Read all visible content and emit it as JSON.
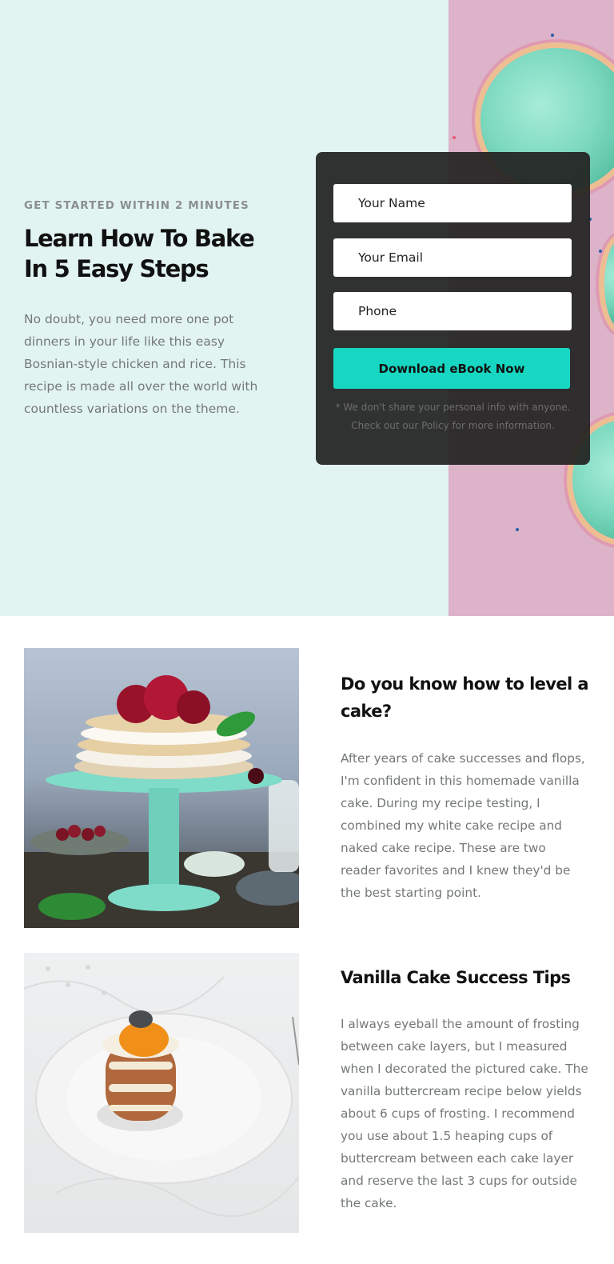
{
  "hero": {
    "eyebrow": "GET STARTED WITHIN 2 MINUTES",
    "headline": "Learn How To Bake In 5 Easy Steps",
    "body": "No doubt, you need more one pot dinners in your life like this easy Bosnian-style chicken and rice. This recipe is made all over the world with countless variations on the theme.",
    "photo_icon": "cupcakes-photo"
  },
  "form": {
    "name_placeholder": "Your Name",
    "email_placeholder": "Your Email",
    "phone_placeholder": "Phone",
    "button_label": "Download eBook Now",
    "disclaimer": "* We don't share your personal info with anyone. Check out our Policy for more information.",
    "button_color": "#17d7c2"
  },
  "features": [
    {
      "title": "Do you know how to level a cake?",
      "body": "After years of cake successes and flops, I'm confident in this homemade vanilla cake. During my recipe testing, I combined my white cake recipe and naked cake recipe. These are two reader favorites and I knew they'd be the best starting point.",
      "image_icon": "layered-cake-on-stand-photo"
    },
    {
      "title": "Vanilla Cake Success Tips",
      "body": "I always eyeball the amount of frosting between cake layers, but I measured when I decorated the pictured cake. The vanilla buttercream recipe below yields about 6 cups of frosting. I recommend you use about 1.5 heaping cups of buttercream between each cake layer and reserve the last 3 cups for outside the cake.",
      "image_icon": "mini-cake-on-plate-photo"
    }
  ],
  "colors": {
    "hero_background": "#e2f4f1",
    "accent": "#17d7c2",
    "form_background": "#222222"
  }
}
